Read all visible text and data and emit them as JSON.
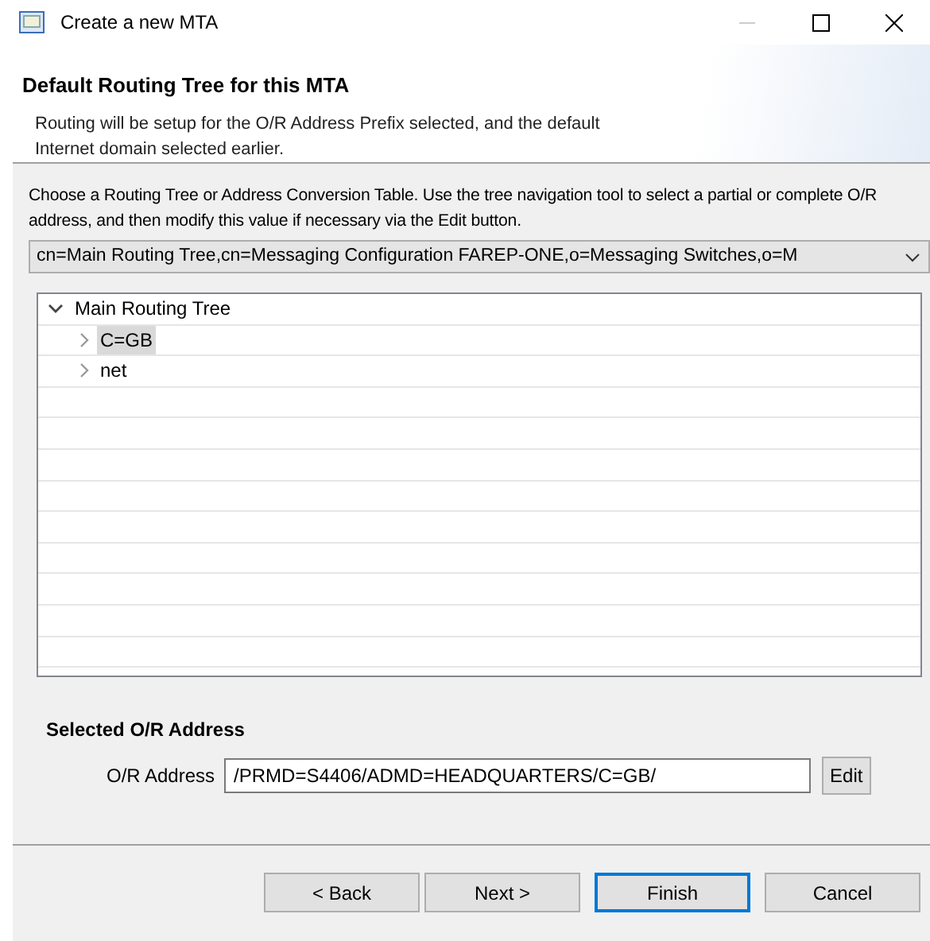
{
  "window": {
    "title": "Create a new MTA"
  },
  "header": {
    "title": "Default Routing Tree for this MTA",
    "description": "Routing will be setup for the O/R Address Prefix selected, and the default Internet domain selected earlier."
  },
  "instructions": "Choose a Routing Tree or Address Conversion Table. Use the tree navigation tool to select a partial or complete O/R address, and then modify this value if necessary via the Edit button.",
  "routing_tree_select": {
    "value": "cn=Main Routing Tree,cn=Messaging Configuration FAREP-ONE,o=Messaging Switches,o=M"
  },
  "tree": [
    {
      "label": "Main Routing Tree",
      "expanded": true,
      "selected": false,
      "children": [
        {
          "label": "C=GB",
          "expanded": false,
          "selected": true
        },
        {
          "label": "net",
          "expanded": false,
          "selected": false
        }
      ]
    }
  ],
  "selected_address": {
    "title": "Selected O/R Address",
    "label": "O/R Address",
    "value": "/PRMD=S4406/ADMD=HEADQUARTERS/C=GB/",
    "edit_button": "Edit"
  },
  "buttons": [
    {
      "label": "< Back",
      "default": false
    },
    {
      "label": "Next >",
      "default": false
    },
    {
      "label": "Finish",
      "default": true
    },
    {
      "label": "Cancel",
      "default": false
    }
  ]
}
